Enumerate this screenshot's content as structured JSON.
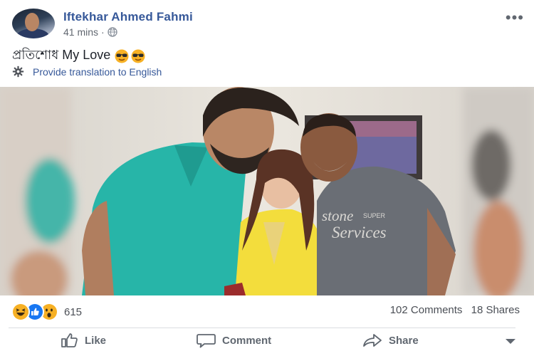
{
  "post": {
    "author": "Iftekhar Ahmed Fahmi",
    "time": "41 mins",
    "time_separator": "·",
    "privacy_icon": "globe-icon",
    "status_text": "প্রতিশোধ My Love",
    "status_emojis": [
      "sunglasses-emoji",
      "sunglasses-emoji"
    ],
    "translate_link": "Provide translation to English",
    "photo_print_text": "stone SUPER Services"
  },
  "stats": {
    "reactions": [
      "haha",
      "like",
      "wow"
    ],
    "reaction_count": "615",
    "comments": "102 Comments",
    "shares": "18 Shares"
  },
  "actions": {
    "like": "Like",
    "comment": "Comment",
    "share": "Share"
  },
  "colors": {
    "link": "#365899",
    "like_blue": "#1877f2",
    "reaction_yellow": "#f7b125",
    "teal_shirt": "#27b5a8",
    "yellow_dress": "#f3dd3c",
    "grey_tshirt": "#6a6e75"
  }
}
